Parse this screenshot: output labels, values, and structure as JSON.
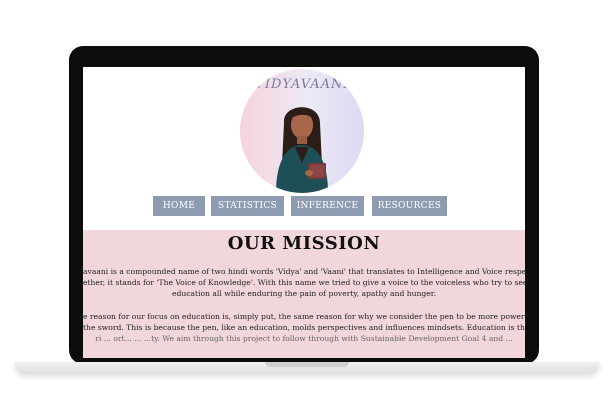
{
  "logo": {
    "title": "VIDYAVAANI"
  },
  "nav": {
    "items": [
      {
        "label": "HOME"
      },
      {
        "label": "STATISTICS"
      },
      {
        "label": "INFERENCE"
      },
      {
        "label": "RESOURCES"
      }
    ]
  },
  "mission": {
    "title": "OUR MISSION",
    "para1_lines": [
      "avaani is a compounded name of two hindi words 'Vidya' and 'Vaani' that translates to Intelligence and Voice respectively.",
      "ether, it stands for 'The Voice of Knowledge'. With this name we tried to give a voice to the voiceless who try to seek",
      "education all while enduring the pain of poverty, apathy and hunger."
    ],
    "para2_lines": [
      "e reason for our focus on education is, simply put, the same reason for why we consider the pen to be more powerful",
      "the sword. This is because the pen, like an education, molds perspectives and influences mindsets. Education is the t",
      "ri ... ort... ... ...ty. We aim through this project to follow through with Sustainable Development Goal 4 and ..."
    ]
  },
  "colors": {
    "nav_bg": "#8e9cb2",
    "mission_bg": "#f1d6da",
    "bezel": "#0d0d0d"
  }
}
